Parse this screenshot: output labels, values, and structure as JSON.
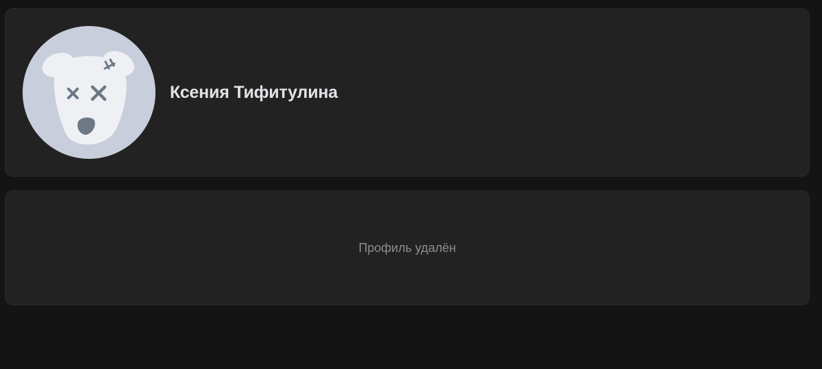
{
  "profile": {
    "name": "Ксения Тифитулина",
    "avatar_icon": "deactivated-dog-icon"
  },
  "status": {
    "text": "Профиль удалён"
  },
  "colors": {
    "page_background": "#141414",
    "card_background": "#222222",
    "avatar_background": "#c8cedb",
    "avatar_face": "#eef0f4",
    "avatar_features": "#6d7885",
    "name_text": "#e1e3e6",
    "status_text": "#8e8e8e"
  }
}
